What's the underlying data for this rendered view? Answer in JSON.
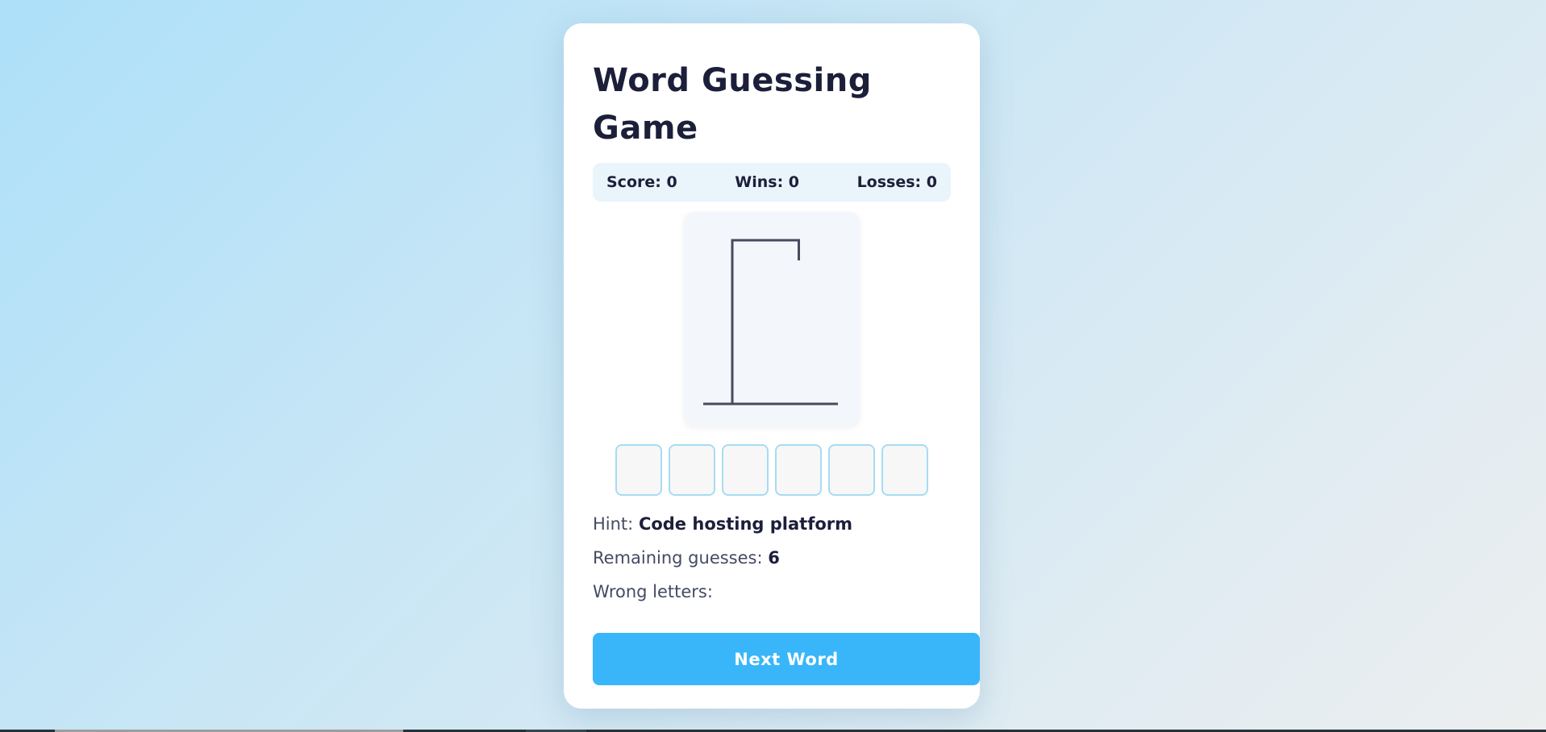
{
  "game": {
    "title": "Word Guessing Game",
    "stats": {
      "score_label": "Score: 0",
      "wins_label": "Wins: 0",
      "losses_label": "Losses: 0"
    },
    "hint_label": "Hint:",
    "hint_value": "Code hosting platform",
    "remaining_label": "Remaining guesses:",
    "remaining_value": "6",
    "wrong_label": "Wrong letters:",
    "wrong_value": "",
    "letter_slots": [
      "",
      "",
      "",
      "",
      "",
      ""
    ],
    "next_button": "Next Word",
    "colors": {
      "accent": "#39b6fa",
      "title": "#1c1f3a",
      "slot_border": "#a6dcf3",
      "gallows_stroke": "#4a4a5e"
    }
  }
}
